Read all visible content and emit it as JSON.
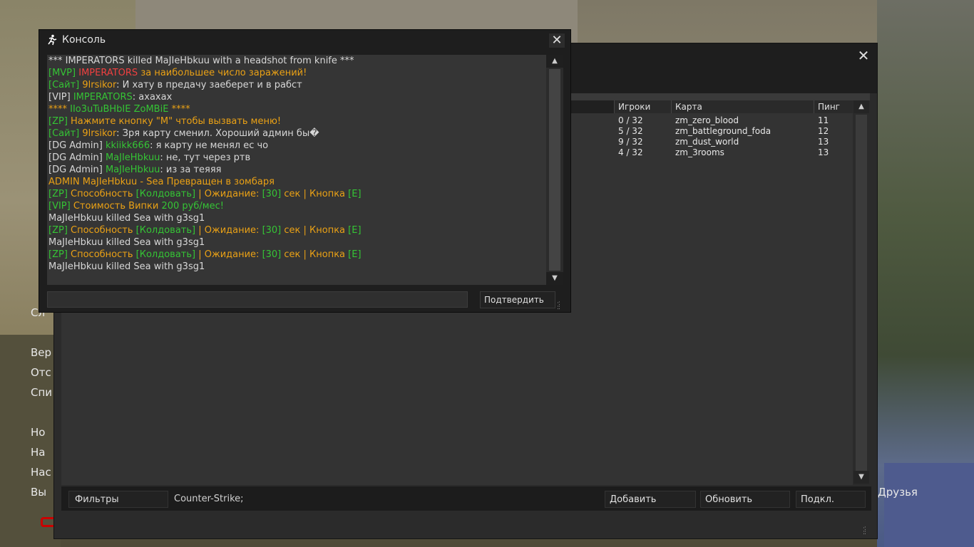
{
  "background_menu": {
    "items": [
      {
        "label": "Сл"
      },
      {
        "label": "Вер"
      },
      {
        "label": "Отс"
      },
      {
        "label": "Спи"
      },
      {
        "label": "Ho"
      },
      {
        "label": "Ha"
      },
      {
        "label": "Hac"
      },
      {
        "label": "Вы"
      }
    ],
    "friends_label": "Друзья"
  },
  "server_browser": {
    "columns": {
      "players": "Игроки",
      "map": "Карта",
      "ping": "Пинг"
    },
    "rows": [
      {
        "players": "0 / 32",
        "map": "zm_zero_blood",
        "ping": "11"
      },
      {
        "players": "5 / 32",
        "map": "zm_battleground_foda",
        "ping": "12"
      },
      {
        "players": "9 / 32",
        "map": "zm_dust_world",
        "ping": "13"
      },
      {
        "players": "4 / 32",
        "map": "zm_3rooms",
        "ping": "13"
      }
    ],
    "filters_label": "Фильтры",
    "filter_text": "Counter-Strike;",
    "add_label": "Добавить",
    "refresh_label": "Обновить",
    "connect_label": "Подкл.",
    "close_glyph": "✕"
  },
  "console": {
    "title": "Консоль",
    "close_glyph": "✕",
    "submit_label": "Подтвердить",
    "input_value": "",
    "lines": [
      [
        {
          "t": "*** IMPERATORS killed MaJIeHbkuu with a headshot from knife ***",
          "c": "w"
        }
      ],
      [
        {
          "t": "[MVP] ",
          "c": "g"
        },
        {
          "t": "IMPERATORS ",
          "c": "r"
        },
        {
          "t": "за наибольшее число заражений!",
          "c": "o"
        }
      ],
      [
        {
          "t": "[Сайт] ",
          "c": "g"
        },
        {
          "t": "9lrsikor",
          "c": "o"
        },
        {
          "t": ": И хату в предачу заеберет и в рабст",
          "c": "w"
        }
      ],
      [
        {
          "t": "[VIP] ",
          "c": "w"
        },
        {
          "t": "IMPERATORS",
          "c": "g"
        },
        {
          "t": ": ахахах",
          "c": "w"
        }
      ],
      [
        {
          "t": "**** ",
          "c": "o"
        },
        {
          "t": "IIo3uTuBHbIE ZoMBiE ",
          "c": "g"
        },
        {
          "t": "****",
          "c": "o"
        }
      ],
      [
        {
          "t": "[ZP] ",
          "c": "g"
        },
        {
          "t": "Нажмите кнопку \"M\" чтобы вызвать меню!",
          "c": "o"
        }
      ],
      [
        {
          "t": "[Сайт] ",
          "c": "g"
        },
        {
          "t": "9lrsikor",
          "c": "o"
        },
        {
          "t": ": Зря карту сменил. Хороший админ бы�",
          "c": "w"
        }
      ],
      [
        {
          "t": "[DG Admin] ",
          "c": "w"
        },
        {
          "t": "kkiikk666",
          "c": "g"
        },
        {
          "t": ": я карту не менял ес чо",
          "c": "w"
        }
      ],
      [
        {
          "t": "[DG Admin] ",
          "c": "w"
        },
        {
          "t": "MaJIeHbkuu",
          "c": "g"
        },
        {
          "t": ": не, тут через ртв",
          "c": "w"
        }
      ],
      [
        {
          "t": "[DG Admin] ",
          "c": "w"
        },
        {
          "t": "MaJIeHbkuu",
          "c": "g"
        },
        {
          "t": ": из за теяяя",
          "c": "w"
        }
      ],
      [
        {
          "t": "ADMIN MaJIeHbkuu - Sea Превращен в зомбаря",
          "c": "o"
        }
      ],
      [
        {
          "t": "[ZP] ",
          "c": "g"
        },
        {
          "t": "Способность ",
          "c": "o"
        },
        {
          "t": "[Колдовать]",
          "c": "g"
        },
        {
          "t": " | Ожидание: ",
          "c": "o"
        },
        {
          "t": "[30]",
          "c": "g"
        },
        {
          "t": " сек | Кнопка ",
          "c": "o"
        },
        {
          "t": "[E]",
          "c": "g"
        }
      ],
      [
        {
          "t": "[VIP] ",
          "c": "g"
        },
        {
          "t": "Стоимость Випки ",
          "c": "o"
        },
        {
          "t": " 200 руб/мес!",
          "c": "g"
        }
      ],
      [
        {
          "t": "MaJIeHbkuu killed Sea with g3sg1",
          "c": "w"
        }
      ],
      [
        {
          "t": "[ZP] ",
          "c": "g"
        },
        {
          "t": "Способность ",
          "c": "o"
        },
        {
          "t": "[Колдовать]",
          "c": "g"
        },
        {
          "t": " | Ожидание: ",
          "c": "o"
        },
        {
          "t": "[30]",
          "c": "g"
        },
        {
          "t": " сек | Кнопка ",
          "c": "o"
        },
        {
          "t": "[E]",
          "c": "g"
        }
      ],
      [
        {
          "t": "MaJIeHbkuu killed Sea with g3sg1",
          "c": "w"
        }
      ],
      [
        {
          "t": "[ZP] ",
          "c": "g"
        },
        {
          "t": "Способность ",
          "c": "o"
        },
        {
          "t": "[Колдовать]",
          "c": "g"
        },
        {
          "t": " | Ожидание: ",
          "c": "o"
        },
        {
          "t": "[30]",
          "c": "g"
        },
        {
          "t": " сек | Кнопка ",
          "c": "o"
        },
        {
          "t": "[E]",
          "c": "g"
        }
      ],
      [
        {
          "t": "MaJIeHbkuu killed Sea with g3sg1",
          "c": "w"
        }
      ]
    ]
  },
  "colors": {
    "green": "#35c435",
    "orange": "#eaa115",
    "red": "#f04040",
    "white": "#d7d7d7"
  },
  "icons": {
    "console_logo": "cs-logo-icon",
    "close": "close-icon",
    "scroll_up": "arrow-up-icon",
    "scroll_down": "arrow-down-icon",
    "resize": "resize-grip-icon"
  }
}
